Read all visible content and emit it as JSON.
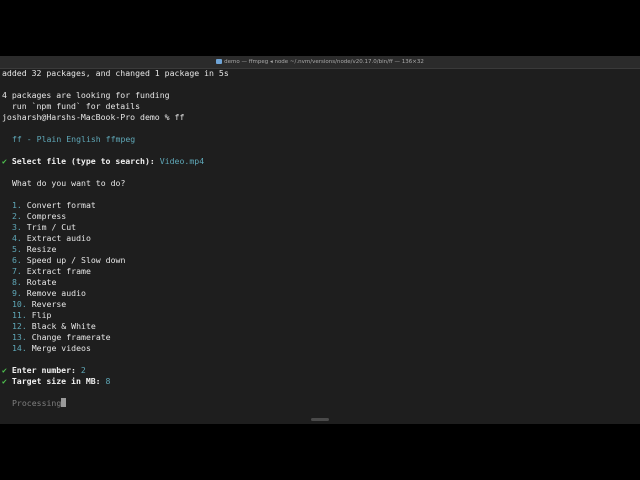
{
  "window": {
    "title": "demo — ffmpeg ◂ node ~/.nvm/versions/node/v20.17.0/bin/ff — 136×32"
  },
  "terminal": {
    "npm_added": "added 32 packages, and changed 1 package in 5s",
    "funding_line1": "4 packages are looking for funding",
    "funding_line2": "  run `npm fund` for details",
    "prompt": "josharsh@Harshs-MacBook-Pro demo % ff",
    "app_header": "ff - Plain English ffmpeg",
    "check_mark": "✔",
    "select_file_label": "Select file (type to search):",
    "select_file_value": "Video.mp4",
    "question": "What do you want to do?",
    "menu": [
      {
        "num": "1.",
        "label": "Convert format"
      },
      {
        "num": "2.",
        "label": "Compress"
      },
      {
        "num": "3.",
        "label": "Trim / Cut"
      },
      {
        "num": "4.",
        "label": "Extract audio"
      },
      {
        "num": "5.",
        "label": "Resize"
      },
      {
        "num": "6.",
        "label": "Speed up / Slow down"
      },
      {
        "num": "7.",
        "label": "Extract frame"
      },
      {
        "num": "8.",
        "label": "Rotate"
      },
      {
        "num": "9.",
        "label": "Remove audio"
      },
      {
        "num": "10.",
        "label": "Reverse"
      },
      {
        "num": "11.",
        "label": "Flip"
      },
      {
        "num": "12.",
        "label": "Black & White"
      },
      {
        "num": "13.",
        "label": "Change framerate"
      },
      {
        "num": "14.",
        "label": "Merge videos"
      }
    ],
    "enter_number_label": "Enter number:",
    "enter_number_value": "2",
    "target_size_label": "Target size in MB:",
    "target_size_value": "8",
    "status": "Processing"
  },
  "colors": {
    "accent_cyan": "#5fa8b8",
    "check_green": "#4fc44f",
    "background": "#1e1e1e"
  },
  "icons": {
    "title_icon": "folder-icon",
    "check_icon": "check-icon"
  }
}
